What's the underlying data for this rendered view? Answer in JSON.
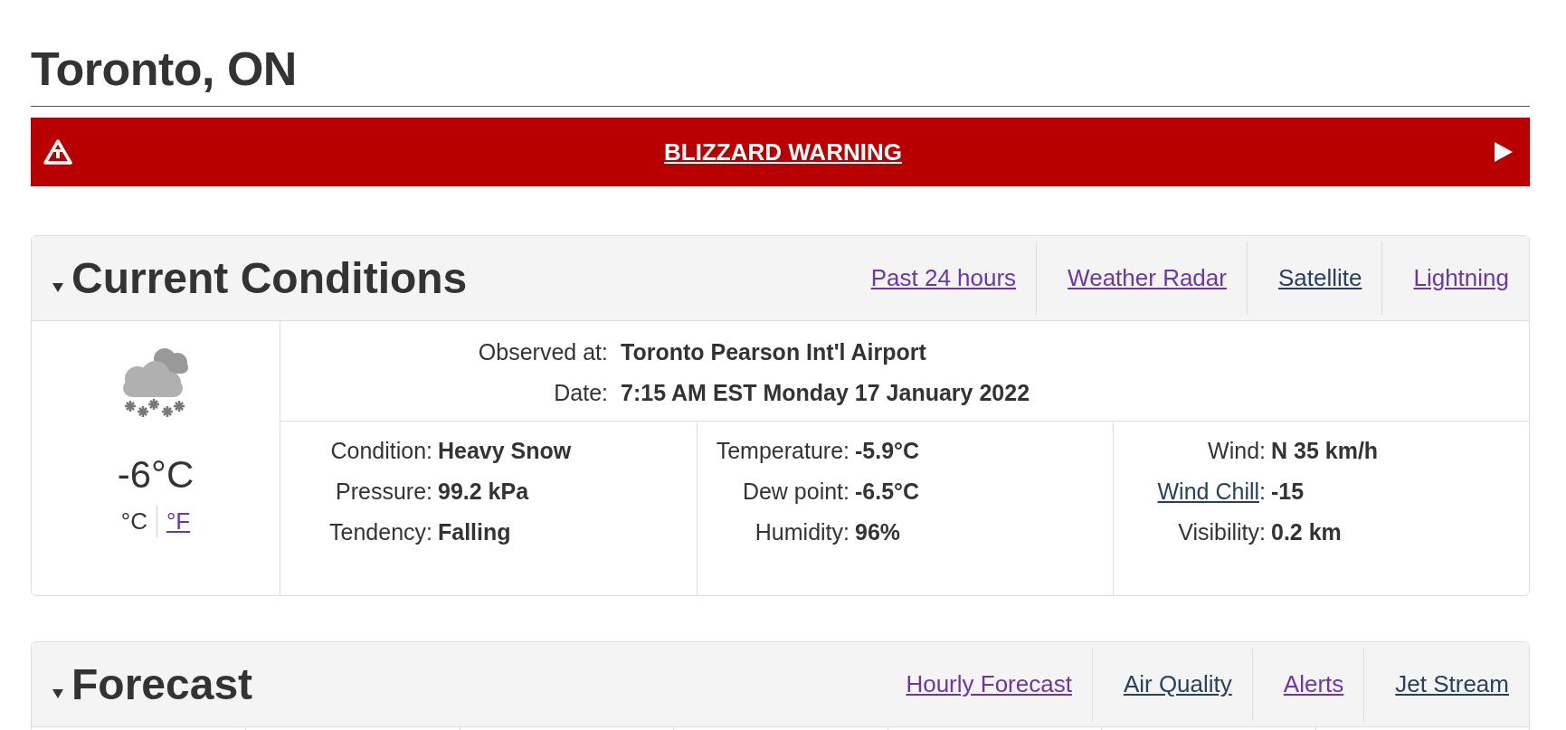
{
  "title": "Toronto, ON",
  "warning": {
    "label": "BLIZZARD WARNING"
  },
  "current": {
    "heading": "Current Conditions",
    "expanded": true,
    "links": [
      {
        "label": "Past 24 hours",
        "visited": true
      },
      {
        "label": "Weather Radar",
        "visited": true
      },
      {
        "label": "Satellite",
        "visited": false
      },
      {
        "label": "Lightning",
        "visited": true
      }
    ],
    "temperature": "-6°C",
    "units": [
      {
        "label": "°C",
        "selected": true
      },
      {
        "label": "°F",
        "selected": false
      }
    ],
    "observed": [
      {
        "label": "Observed at:",
        "value": "Toronto Pearson Int'l Airport"
      },
      {
        "label": "Date:",
        "value": "7:15 AM EST Monday 17 January 2022"
      }
    ],
    "columns": [
      [
        {
          "label": "Condition:",
          "value": "Heavy Snow"
        },
        {
          "label": "Pressure:",
          "value": "99.2 kPa"
        },
        {
          "label": "Tendency:",
          "value": "Falling"
        }
      ],
      [
        {
          "label": "Temperature:",
          "value": "-5.9°C"
        },
        {
          "label": "Dew point:",
          "value": "-6.5°C"
        },
        {
          "label": "Humidity:",
          "value": "96%"
        }
      ],
      [
        {
          "label": "Wind:",
          "value": "N 35 km/h"
        },
        {
          "label": "Wind Chill",
          "link": true,
          "suffix": ":",
          "value": "-15"
        },
        {
          "label": "Visibility:",
          "value": "0.2 km"
        }
      ]
    ]
  },
  "forecast": {
    "heading": "Forecast",
    "expanded": true,
    "links": [
      {
        "label": "Hourly Forecast",
        "visited": true
      },
      {
        "label": "Air Quality",
        "visited": false
      },
      {
        "label": "Alerts",
        "visited": true
      },
      {
        "label": "Jet Stream",
        "visited": false
      }
    ]
  }
}
